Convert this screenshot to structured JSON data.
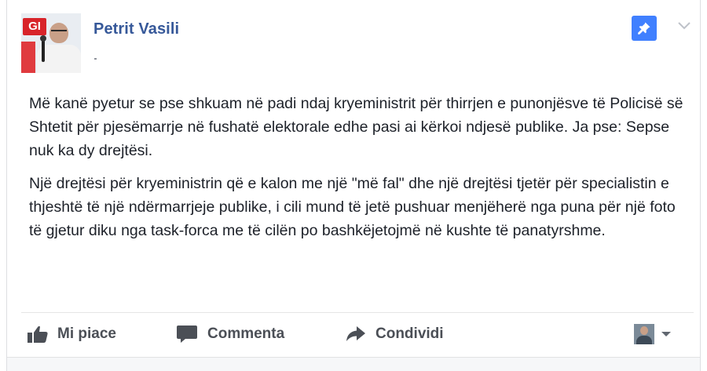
{
  "post": {
    "author": "Petrit Vasili",
    "avatar_logo_text": "GI",
    "paragraphs": [
      "Më kanë pyetur se pse shkuam në padi ndaj kryeministrit për thirrjen e punonjësve të Policisë së Shtetit për pjesëmarrje në fushatë elektorale edhe pasi ai kërkoi ndjesë publike. Ja pse: Sepse nuk ka dy drejtësi.",
      "Një drejtësi për kryeministrin që e kalon me një \"më fal\" dhe një drejtësi tjetër për specialistin e thjeshtë të një ndërmarrjeje publike, i cili mund të jetë pushuar menjëherë nga puna për një foto të gjetur diku nga task-forca me të cilën po bashkëjetojmë në kushte të panatyrshme."
    ]
  },
  "actions": {
    "like_label": "Mi piace",
    "comment_label": "Commenta",
    "share_label": "Condividi"
  },
  "icons": {
    "pin": "pin-icon",
    "chevron": "chevron-down-icon",
    "like": "thumbs-up-icon",
    "comment": "comment-bubble-icon",
    "share": "share-arrow-icon",
    "caret": "caret-down-icon"
  },
  "colors": {
    "author_link": "#365899",
    "pin_button": "#4080ff",
    "action_text": "#4b4f56",
    "body_text": "#1d2129"
  }
}
